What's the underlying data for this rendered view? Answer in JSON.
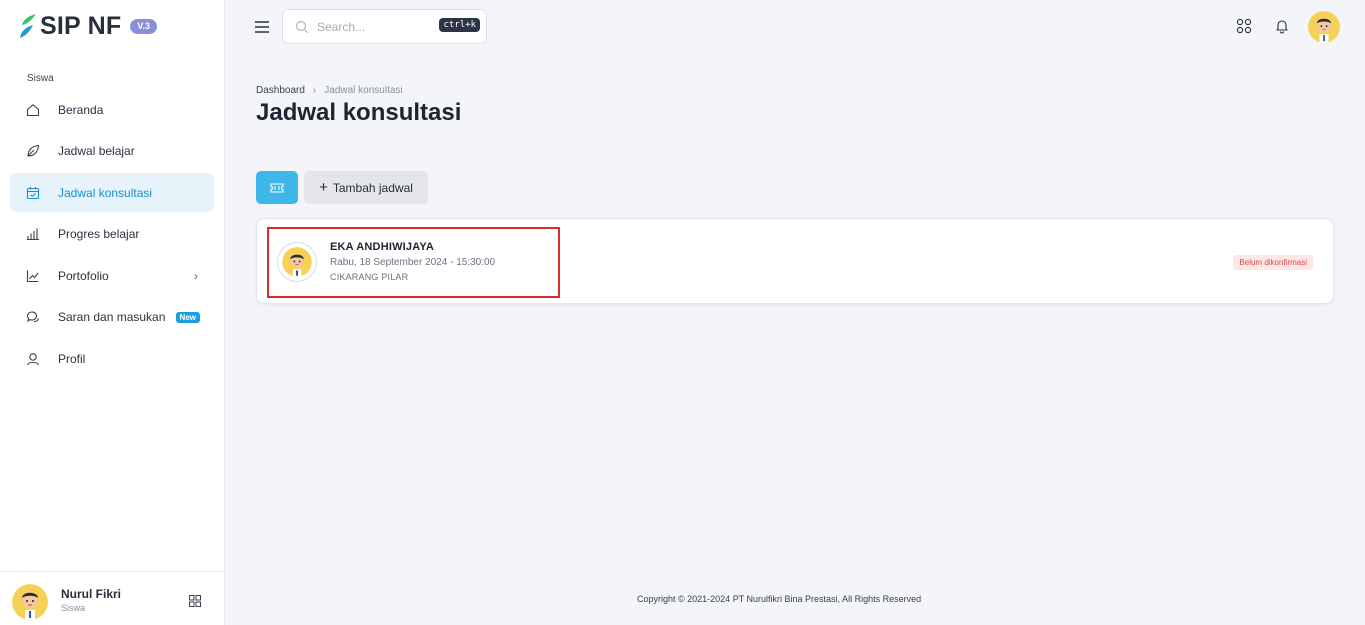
{
  "brand": {
    "name": "SIP NF",
    "version": "V.3"
  },
  "sidebar": {
    "section": "Siswa",
    "items": [
      {
        "label": "Beranda",
        "icon": "home-icon"
      },
      {
        "label": "Jadwal belajar",
        "icon": "leaf-icon"
      },
      {
        "label": "Jadwal konsultasi",
        "icon": "calendar-check-icon",
        "active": true
      },
      {
        "label": "Progres belajar",
        "icon": "bar-chart-icon"
      },
      {
        "label": "Portofolio",
        "icon": "trend-chart-icon",
        "chevron": "›"
      },
      {
        "label": "Saran dan masukan",
        "icon": "chat-icon",
        "badge": "New"
      },
      {
        "label": "Profil",
        "icon": "user-icon"
      }
    ],
    "user": {
      "name": "Nurul Fikri",
      "role": "Siswa"
    }
  },
  "header": {
    "search": {
      "placeholder": "Search...",
      "shortcut": "ctrl+k"
    }
  },
  "breadcrumb": {
    "home": "Dashboard",
    "separator": "›",
    "current": "Jadwal konsultasi"
  },
  "page": {
    "title": "Jadwal konsultasi",
    "add_button": "Tambah jadwal",
    "add_icon": "+"
  },
  "schedule": {
    "name": "EKA ANDHIWIJAYA",
    "datetime": "Rabu, 18 September 2024 - 15:30:00",
    "location": "CIKARANG PILAR",
    "status": "Belum dikonfirmasi"
  },
  "footer": {
    "text": "Copyright © 2021-2024 PT Nurulfikri Bina Prestasi, All Rights Reserved"
  },
  "colors": {
    "accent": "#1a8fd1",
    "primary_button": "#3fb6e8",
    "status_red": "#e04848",
    "highlight": "#e0292b"
  }
}
